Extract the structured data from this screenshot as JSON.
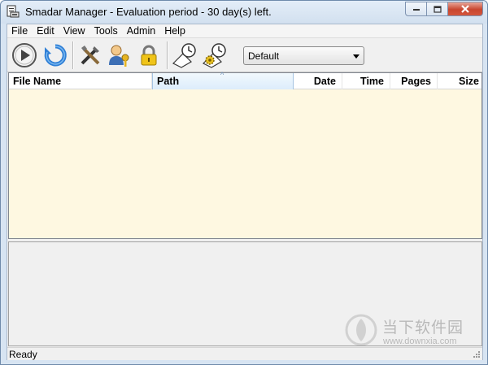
{
  "window": {
    "title": "Smadar Manager - Evaluation period - 30 day(s) left.",
    "app_icon": "printer-document-icon",
    "controls": [
      "minimize-icon",
      "maximize-icon",
      "close-icon"
    ]
  },
  "menu": [
    "File",
    "Edit",
    "View",
    "Tools",
    "Admin",
    "Help"
  ],
  "toolbar": {
    "buttons": [
      {
        "name": "play",
        "icon": "play-icon"
      },
      {
        "name": "refresh",
        "icon": "refresh-icon"
      },
      {
        "name": "tools",
        "icon": "tools-icon"
      },
      {
        "name": "user-key",
        "icon": "user-key-icon"
      },
      {
        "name": "lock",
        "icon": "lock-icon"
      },
      {
        "name": "schedule",
        "icon": "schedule-clock-icon"
      },
      {
        "name": "schedule-settings",
        "icon": "schedule-gear-icon"
      }
    ],
    "profile_select": {
      "value": "Default"
    }
  },
  "list": {
    "columns": [
      "File Name",
      "Path",
      "Date",
      "Time",
      "Pages",
      "Size"
    ],
    "sorted_column": "Path",
    "rows": []
  },
  "status": {
    "text": "Ready"
  },
  "watermark": {
    "text_cn": "当下软件园",
    "url": "www.downxia.com"
  },
  "colors": {
    "list_background": "#fef8e1",
    "titlebar": "#d7e4f2",
    "close_button": "#c8462f"
  }
}
